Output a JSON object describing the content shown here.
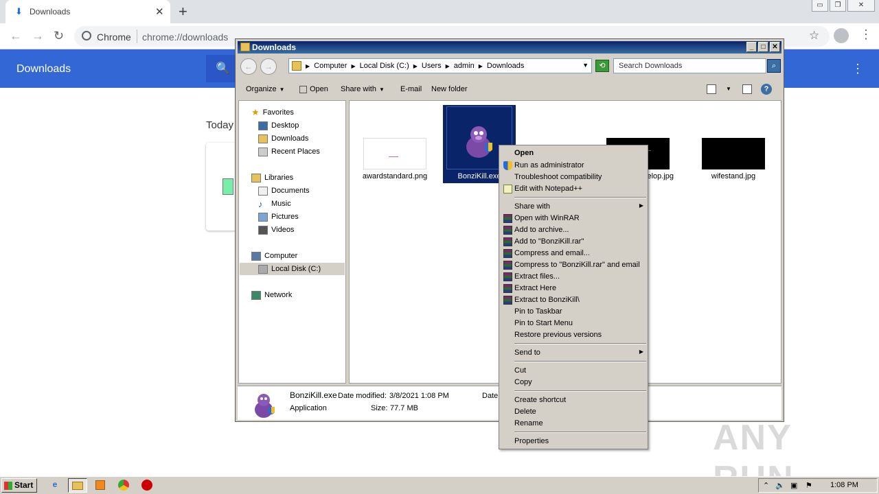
{
  "chrome": {
    "tab_title": "Downloads",
    "omnibox_site": "Chrome",
    "omnibox_url": "chrome://downloads",
    "page_title": "Downloads",
    "section_today": "Today"
  },
  "explorer": {
    "window_title": "Downloads",
    "breadcrumbs": [
      "Computer",
      "Local Disk (C:)",
      "Users",
      "admin",
      "Downloads"
    ],
    "search_placeholder": "Search Downloads",
    "commands": {
      "organize": "Organize",
      "open": "Open",
      "share_with": "Share with",
      "email": "E-mail",
      "new_folder": "New folder"
    },
    "nav": {
      "favorites": "Favorites",
      "desktop": "Desktop",
      "downloads": "Downloads",
      "recent_places": "Recent Places",
      "libraries": "Libraries",
      "documents": "Documents",
      "music": "Music",
      "pictures": "Pictures",
      "videos": "Videos",
      "computer": "Computer",
      "local_disk": "Local Disk (C:)",
      "network": "Network"
    },
    "files": [
      {
        "name": "awardstandard.png"
      },
      {
        "name": "BonziKill.exe"
      },
      {
        "name": "velop.jpg"
      },
      {
        "name": "wifestand.jpg"
      }
    ],
    "details": {
      "name": "BonziKill.exe",
      "type": "Application",
      "modified_label": "Date modified:",
      "modified_value": "3/8/2021 1:08 PM",
      "size_label": "Size:",
      "size_value": "77.7 MB",
      "date_label": "Date"
    }
  },
  "context_menu": {
    "open": "Open",
    "run_as_admin": "Run as administrator",
    "troubleshoot": "Troubleshoot compatibility",
    "edit_notepad": "Edit with Notepad++",
    "share_with": "Share with",
    "open_winrar": "Open with WinRAR",
    "add_archive": "Add to archive...",
    "add_rar": "Add to \"BonziKill.rar\"",
    "compress_email": "Compress and email...",
    "compress_rar_email": "Compress to \"BonziKill.rar\" and email",
    "extract_files": "Extract files...",
    "extract_here": "Extract Here",
    "extract_to": "Extract to BonziKill\\",
    "pin_taskbar": "Pin to Taskbar",
    "pin_start": "Pin to Start Menu",
    "restore_versions": "Restore previous versions",
    "send_to": "Send to",
    "cut": "Cut",
    "copy": "Copy",
    "create_shortcut": "Create shortcut",
    "delete": "Delete",
    "rename": "Rename",
    "properties": "Properties"
  },
  "taskbar": {
    "start": "Start",
    "clock": "1:08 PM"
  },
  "watermark": "ANY RUN"
}
